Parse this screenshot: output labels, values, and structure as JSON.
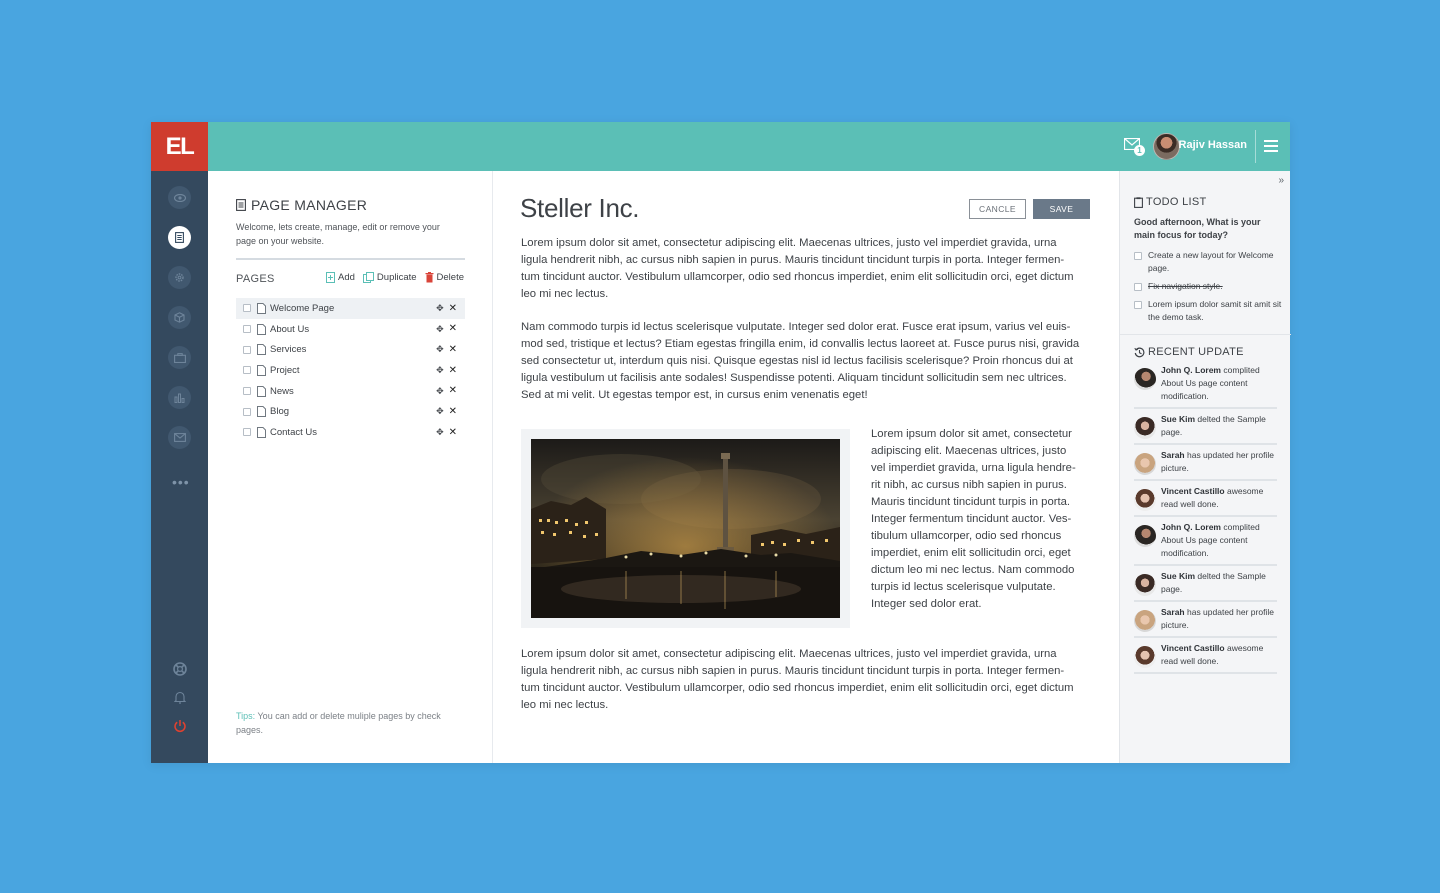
{
  "brand": {
    "logo_text": "EL",
    "logo_color": "#cf3c2e",
    "topbar_color": "#5bbfb6",
    "sidebar_color": "#34495e"
  },
  "topbar": {
    "mail_count": "1",
    "user_name": "Rajiv Hassan"
  },
  "sidebar": {
    "icons": [
      "eye-icon",
      "document-icon",
      "gear-icon",
      "cube-icon",
      "briefcase-icon",
      "bar-chart-icon",
      "mail-icon"
    ],
    "bottom_icons": [
      "lifebuoy-icon",
      "bell-icon",
      "power-icon"
    ]
  },
  "page_manager": {
    "title": "PAGE MANAGER",
    "description": "Welcome, lets create, manage, edit or remove your page on your website.",
    "pages_label": "PAGES",
    "add_label": "Add",
    "duplicate_label": "Duplicate",
    "delete_label": "Delete",
    "pages": [
      {
        "label": "Welcome Page"
      },
      {
        "label": "About Us"
      },
      {
        "label": "Services"
      },
      {
        "label": "Project"
      },
      {
        "label": "News"
      },
      {
        "label": "Blog"
      },
      {
        "label": "Contact Us"
      }
    ],
    "tips_label": "Tips:",
    "tips_text": " You can add or delete muliple pages by check pages."
  },
  "editor": {
    "title": "Steller Inc.",
    "cancel_label": "CANCLE",
    "save_label": "SAVE",
    "paragraph1": "Lorem ipsum dolor sit amet, consectetur adipiscing elit. Maecenas ultrices, justo vel imperdiet gravida, urna ligula hendrerit nibh, ac cursus nibh sapien in purus. Mauris tincidunt tincidunt turpis in porta. Integer fermen-tum tincidunt auctor. Vestibulum ullamcorper, odio sed rhoncus imperdiet, enim elit sollicitudin orci, eget dictum leo mi nec lectus.",
    "paragraph2": "Nam commodo turpis id lectus scelerisque vulputate. Integer sed dolor erat. Fusce erat ipsum, varius vel euis-mod sed, tristique et lectus? Etiam egestas fringilla enim, id convallis lectus laoreet at. Fusce purus nisi, gravida sed consectetur ut, interdum quis nisi. Quisque egestas nisl id lectus facilisis scelerisque? Proin rhoncus dui at ligula vestibulum ut facilisis ante sodales! Suspendisse potenti. Aliquam tincidunt sollicitudin sem nec ultrices. Sed at mi velit. Ut egestas tempor est, in cursus enim venenatis eget!",
    "paragraph3": "Lorem ipsum dolor sit amet, consectetur adipiscing elit. Maecenas ultrices, justo vel imperdiet gravida, urna ligula hendre-rit nibh, ac cursus nibh sapien in purus. Mauris tincidunt tincidunt turpis in porta. Integer fermentum tincidunt auctor. Ves-tibulum ullamcorper, odio sed rhoncus imperdiet, enim elit sollicitudin orci, eget dictum leo mi nec lectus. Nam commodo turpis id lectus scelerisque vulputate. Integer sed dolor erat.",
    "paragraph4": "Lorem ipsum dolor sit amet, consectetur adipiscing elit. Maecenas ultrices, justo vel imperdiet gravida, urna ligula hendrerit nibh, ac cursus nibh sapien in purus. Mauris tincidunt tincidunt turpis in porta. Integer fermen-tum tincidunt auctor. Vestibulum ullamcorper, odio sed rhoncus imperdiet, enim elit sollicitudin orci, eget dictum leo mi nec lectus."
  },
  "todo": {
    "title": "TODO LIST",
    "greeting": "Good afternoon, What is your main focus for today?",
    "items": [
      {
        "text": "Create a new layout for Welcome page.",
        "done": false
      },
      {
        "text": "Fix navigation style.",
        "done": true
      },
      {
        "text": "Lorem ipsum dolor samit sit amit sit the demo task.",
        "done": false
      }
    ]
  },
  "recent": {
    "title": "RECENT UPDATE",
    "items": [
      {
        "name": "John Q. Lorem",
        "text": " complited About Us page content modification."
      },
      {
        "name": "Sue Kim",
        "text": " delted the Sample page."
      },
      {
        "name": "Sarah",
        "text": " has updated her profile picture."
      },
      {
        "name": "Vincent Castillo",
        "text": " awesome read well done."
      },
      {
        "name": "John Q. Lorem",
        "text": " complited About Us page content modification."
      },
      {
        "name": "Sue Kim",
        "text": " delted the Sample page."
      },
      {
        "name": "Sarah",
        "text": " has updated her profile picture."
      },
      {
        "name": "Vincent Castillo",
        "text": " awesome read well done."
      }
    ]
  }
}
